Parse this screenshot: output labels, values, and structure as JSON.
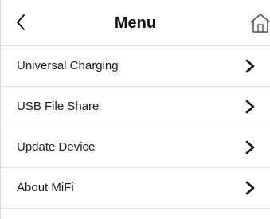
{
  "header": {
    "title": "Menu",
    "back_icon": "chevron-left-icon",
    "home_icon": "home-icon"
  },
  "menu": {
    "items": [
      {
        "label": "Universal Charging",
        "icon": "chevron-right-icon"
      },
      {
        "label": "USB File Share",
        "icon": "chevron-right-icon"
      },
      {
        "label": "Update Device",
        "icon": "chevron-right-icon"
      },
      {
        "label": "About MiFi",
        "icon": "chevron-right-icon"
      }
    ]
  },
  "colors": {
    "text": "#1a1a1a",
    "divider": "#e3e3e3",
    "background": "#ffffff"
  }
}
